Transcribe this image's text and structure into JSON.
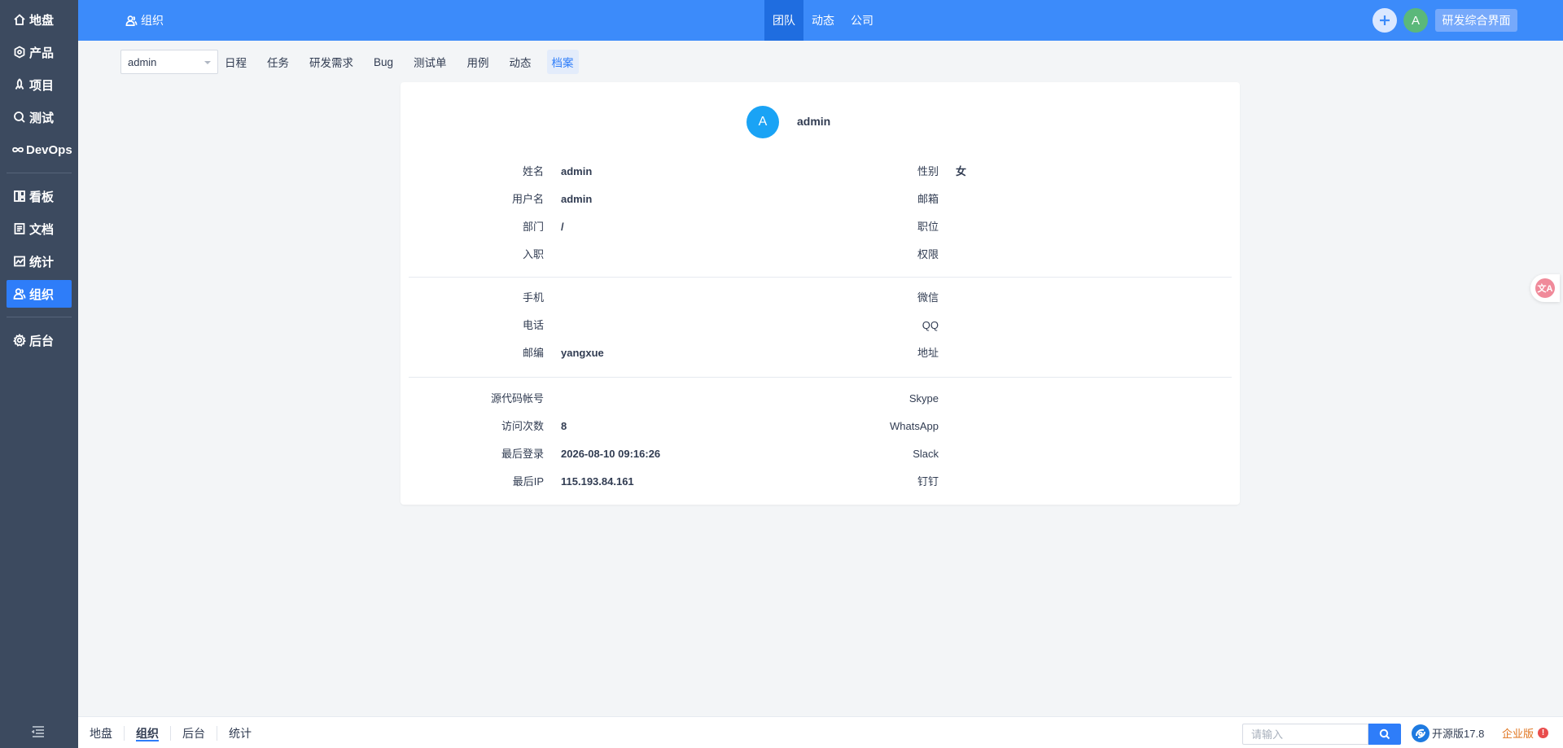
{
  "sidebar": {
    "items": [
      {
        "label": "地盘",
        "icon": "home-icon"
      },
      {
        "label": "产品",
        "icon": "product-icon"
      },
      {
        "label": "项目",
        "icon": "project-icon"
      },
      {
        "label": "测试",
        "icon": "test-icon"
      },
      {
        "label": "DevOps",
        "icon": "devops-icon"
      },
      {
        "label": "看板",
        "icon": "kanban-icon"
      },
      {
        "label": "文档",
        "icon": "doc-icon"
      },
      {
        "label": "统计",
        "icon": "chart-icon"
      },
      {
        "label": "组织",
        "icon": "org-icon",
        "active": true
      },
      {
        "label": "后台",
        "icon": "gear-icon"
      }
    ]
  },
  "header": {
    "title": "组织",
    "nav": [
      {
        "label": "团队",
        "active": true
      },
      {
        "label": "动态"
      },
      {
        "label": "公司"
      }
    ],
    "avatar_letter": "A",
    "rd_button": "研发综合界面"
  },
  "subnav": {
    "user_select": "admin",
    "tabs": [
      {
        "label": "日程"
      },
      {
        "label": "任务"
      },
      {
        "label": "研发需求"
      },
      {
        "label": "Bug"
      },
      {
        "label": "测试单"
      },
      {
        "label": "用例"
      },
      {
        "label": "动态"
      },
      {
        "label": "档案",
        "active": true
      }
    ]
  },
  "profile": {
    "avatar_letter": "A",
    "name": "admin",
    "basic": {
      "realname_label": "姓名",
      "realname": "admin",
      "gender_label": "性别",
      "gender": "女",
      "account_label": "用户名",
      "account": "admin",
      "email_label": "邮箱",
      "email": "",
      "dept_label": "部门",
      "dept": "/",
      "role_label": "职位",
      "role": "",
      "join_label": "入职",
      "join": "",
      "priv_label": "权限",
      "priv": ""
    },
    "contact": {
      "mobile_label": "手机",
      "mobile": "",
      "weixin_label": "微信",
      "weixin": "",
      "phone_label": "电话",
      "phone": "",
      "qq_label": "QQ",
      "qq": "",
      "zipcode_label": "邮编",
      "zipcode": "yangxue",
      "address_label": "地址",
      "address": ""
    },
    "other": {
      "scm_label": "源代码帐号",
      "scm": "",
      "skype_label": "Skype",
      "skype": "",
      "visits_label": "访问次数",
      "visits": "8",
      "whatsapp_label": "WhatsApp",
      "whatsapp": "",
      "last_login_label": "最后登录",
      "last_login": "2026-08-10 09:16:26",
      "slack_label": "Slack",
      "slack": "",
      "last_ip_label": "最后IP",
      "last_ip": "115.193.84.161",
      "dingding_label": "钉钉",
      "dingding": ""
    }
  },
  "footer": {
    "crumbs": [
      {
        "label": "地盘"
      },
      {
        "label": "组织",
        "active": true
      },
      {
        "label": "后台"
      },
      {
        "label": "统计"
      }
    ],
    "search_placeholder": "请输入",
    "version": "开源版17.8",
    "edition": "企业版",
    "edition_badge": "!"
  },
  "colors": {
    "sidebar_bg": "#3c4a5f",
    "header_bg": "#3c8bfa",
    "accent": "#2e7df9",
    "avatar_bg": "#1aa3f5",
    "user_avatar_bg": "#5bb87a"
  }
}
